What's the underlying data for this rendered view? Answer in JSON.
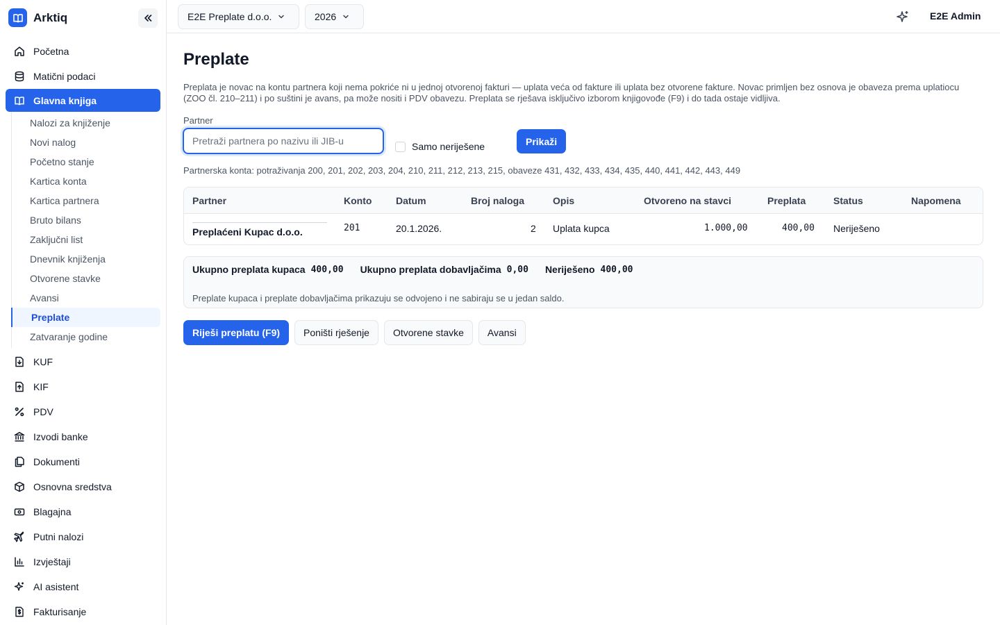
{
  "app": {
    "name": "Arktiq"
  },
  "sidebar": {
    "items_top": [
      {
        "label": "Početna",
        "icon": "home-icon"
      },
      {
        "label": "Matični podaci",
        "icon": "database-icon"
      },
      {
        "label": "Glavna knjiga",
        "icon": "book-icon"
      }
    ],
    "sub_items": [
      "Nalozi za knjiženje",
      "Novi nalog",
      "Početno stanje",
      "Kartica konta",
      "Kartica partnera",
      "Bruto bilans",
      "Zaključni list",
      "Dnevnik knjiženja",
      "Otvorene stavke",
      "Avansi",
      "Preplate",
      "Zatvaranje godine"
    ],
    "items_bottom": [
      {
        "label": "KUF",
        "icon": "file-download-icon"
      },
      {
        "label": "KIF",
        "icon": "file-upload-icon"
      },
      {
        "label": "PDV",
        "icon": "percent-icon"
      },
      {
        "label": "Izvodi banke",
        "icon": "bank-icon"
      },
      {
        "label": "Dokumenti",
        "icon": "documents-icon"
      },
      {
        "label": "Osnovna sredstva",
        "icon": "box-icon"
      },
      {
        "label": "Blagajna",
        "icon": "cash-icon"
      },
      {
        "label": "Putni nalozi",
        "icon": "plane-icon"
      },
      {
        "label": "Izvještaji",
        "icon": "bar-chart-icon"
      },
      {
        "label": "AI asistent",
        "icon": "sparkles-icon"
      },
      {
        "label": "Fakturisanje",
        "icon": "invoice-icon"
      }
    ]
  },
  "topbar": {
    "company": "E2E Preplate d.o.o.",
    "year": "2026",
    "user": "E2E Admin"
  },
  "page": {
    "title": "Preplate",
    "description": "Preplata je novac na kontu partnera koji nema pokriće ni u jednoj otvorenoj fakturi — uplata veća od fakture ili uplata bez otvorene fakture. Novac primljen bez osnova je obaveza prema uplatiocu (ZOO čl. 210–211) i po suštini je avans, pa može nositi i PDV obavezu. Preplata se rješava isključivo izborom knjigovođe (F9) i do tada ostaje vidljiva.",
    "partner_label": "Partner",
    "partner_placeholder": "Pretraži partnera po nazivu ili JIB-u",
    "partner_value": "",
    "only_unresolved_label": "Samo neriješene",
    "show_button": "Prikaži",
    "konta_text": "Partnerska konta: potraživanja 200, 201, 202, 203, 204, 210, 211, 212, 213, 215, obaveze 431, 432, 433, 434, 435, 440, 441, 442, 443, 449"
  },
  "table": {
    "headers": {
      "partner": "Partner",
      "konto": "Konto",
      "datum": "Datum",
      "broj": "Broj naloga",
      "opis": "Opis",
      "otvoreno": "Otvoreno na stavci",
      "preplata": "Preplata",
      "status": "Status",
      "napomena": "Napomena"
    },
    "rows": [
      {
        "partner": "Preplaćeni Kupac d.o.o.",
        "konto": "201",
        "datum": "20.1.2026.",
        "broj": "2",
        "opis": "Uplata kupca",
        "otvoreno": "1.000,00",
        "preplata": "400,00",
        "status": "Neriješeno",
        "napomena": ""
      }
    ]
  },
  "summary": {
    "kupci_label": "Ukupno preplata kupaca",
    "kupci_value": "400,00",
    "dob_label": "Ukupno preplata dobavljačima",
    "dob_value": "0,00",
    "neriješeno_label": "Neriješeno",
    "neriješeno_value": "400,00",
    "note": "Preplate kupaca i preplate dobavljačima prikazuju se odvojeno i ne sabiraju se u jedan saldo."
  },
  "actions": {
    "resolve": "Riješi preplatu (F9)",
    "cancel": "Poništi rješenje",
    "open_items": "Otvorene stavke",
    "advances": "Avansi"
  },
  "colors": {
    "accent": "#2563eb",
    "sub_active_bg": "#eff6ff"
  }
}
